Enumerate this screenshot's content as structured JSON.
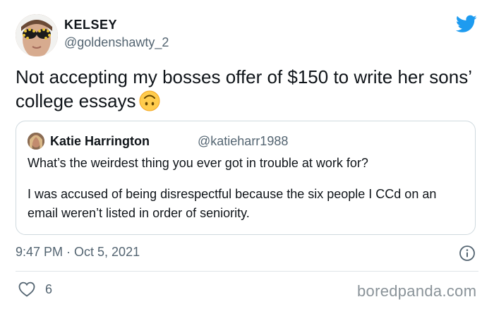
{
  "author": {
    "display_name": "KELSEY",
    "handle": "@goldenshawty_2",
    "avatar_icon": "user-avatar-sunglasses"
  },
  "tweet": {
    "text": "Not accepting my bosses offer of $150 to write her sons’ college essays",
    "emoji": "upside-down-face"
  },
  "quoted_tweet": {
    "display_name": "Katie Harrington",
    "handle": "@katieharr1988",
    "paragraph_1": "What’s the weirdest thing you ever got in trouble at work for?",
    "paragraph_2": "I was accused of being disrespectful because the six people I CCd on an email weren’t listed in order of seniority."
  },
  "meta": {
    "timestamp": "9:47 PM · Oct 5, 2021",
    "like_count": "6"
  },
  "watermark": "boredpanda.com",
  "colors": {
    "twitter_blue": "#1d9bf0",
    "secondary_text": "#536471",
    "border": "#cfd9de"
  }
}
